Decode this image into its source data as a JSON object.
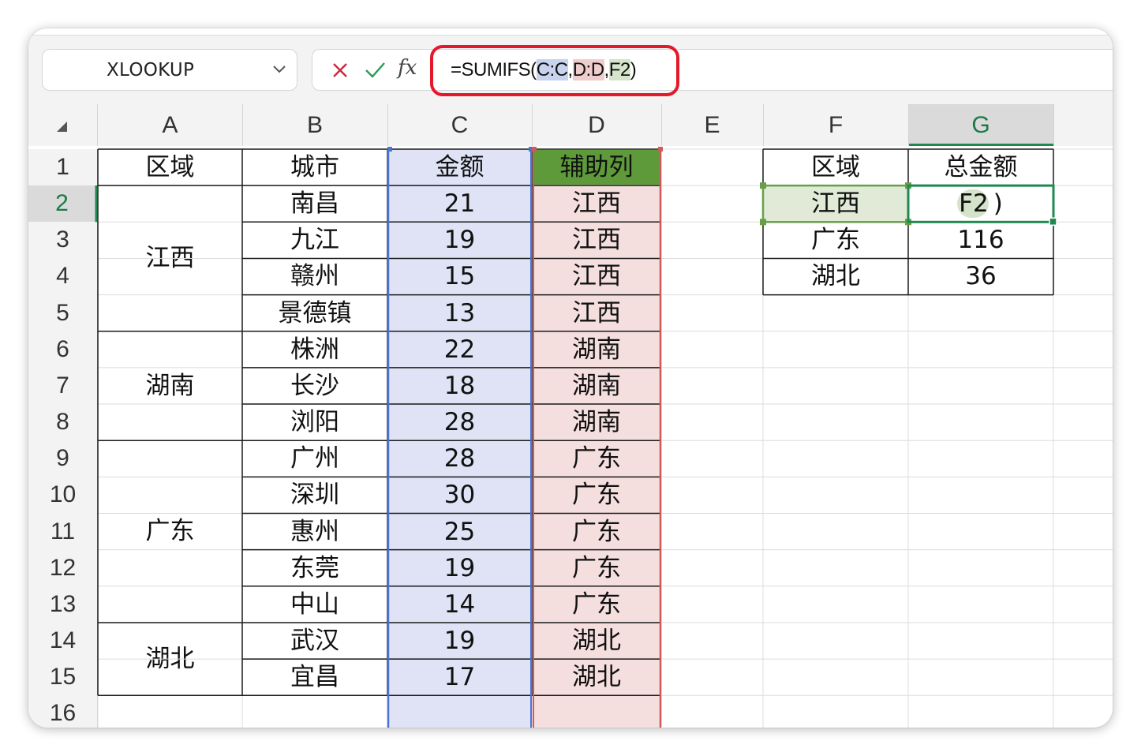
{
  "formula_bar": {
    "name_box": "XLOOKUP",
    "fx_label": "fx",
    "formula_prefix": "=SUMIFS(",
    "arg1": "C:C",
    "comma1": ",",
    "arg2": "D:D",
    "comma2": ",",
    "arg3": "F2",
    "formula_suffix": ")"
  },
  "columns": [
    "A",
    "B",
    "C",
    "D",
    "E",
    "F",
    "G"
  ],
  "selected_column": "G",
  "rows": [
    "1",
    "2",
    "3",
    "4",
    "5",
    "6",
    "7",
    "8",
    "9",
    "10",
    "11",
    "12",
    "13",
    "14",
    "15",
    "16"
  ],
  "selected_row": "2",
  "table": {
    "headers": {
      "region": "区域",
      "city": "城市",
      "amount": "金额",
      "helper": "辅助列"
    },
    "regions": [
      "江西",
      "湖南",
      "广东",
      "湖北"
    ],
    "cities": [
      "南昌",
      "九江",
      "赣州",
      "景德镇",
      "株洲",
      "长沙",
      "浏阳",
      "广州",
      "深圳",
      "惠州",
      "东莞",
      "中山",
      "武汉",
      "宜昌"
    ],
    "amounts": [
      "21",
      "19",
      "15",
      "13",
      "22",
      "18",
      "28",
      "28",
      "30",
      "25",
      "19",
      "14",
      "19",
      "17"
    ],
    "helper": [
      "江西",
      "江西",
      "江西",
      "江西",
      "湖南",
      "湖南",
      "湖南",
      "广东",
      "广东",
      "广东",
      "广东",
      "广东",
      "湖北",
      "湖北"
    ]
  },
  "summary": {
    "headers": {
      "region": "区域",
      "total": "总金额"
    },
    "rows": [
      {
        "region": "江西",
        "total": "F2",
        "total_suffix": ")"
      },
      {
        "region": "广东",
        "total": "116"
      },
      {
        "region": "湖北",
        "total": "36"
      }
    ]
  },
  "colors": {
    "accent_green": "#1e8a50",
    "highlight_red": "#e4182a",
    "range_blue": "#dfe3f5",
    "range_red": "#f4dede",
    "helper_header_green": "#5e9a3a"
  }
}
